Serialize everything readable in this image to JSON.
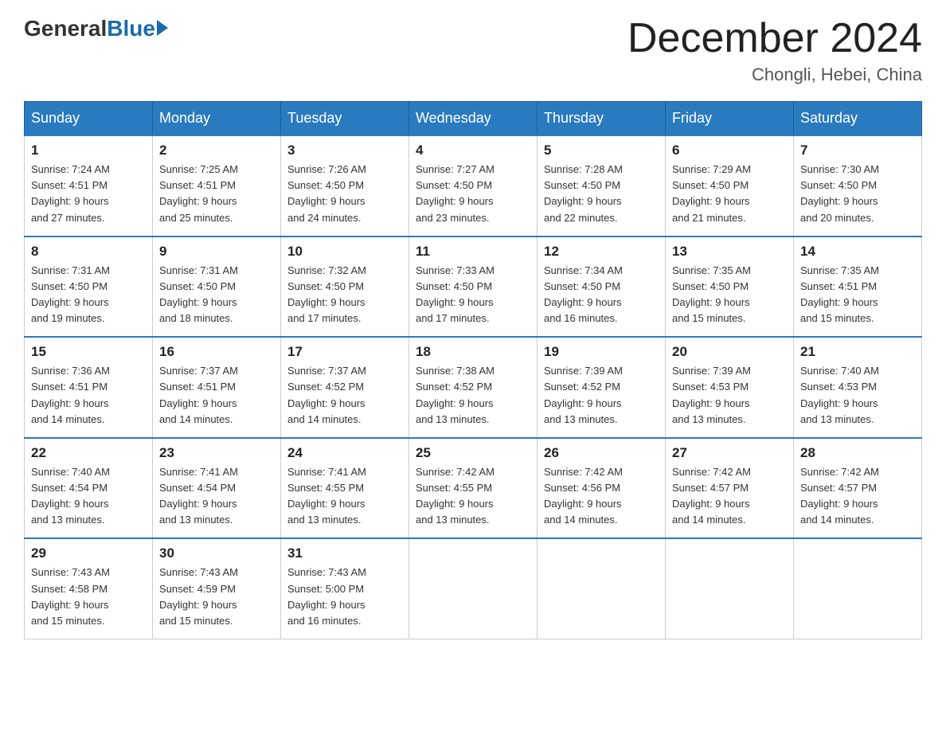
{
  "logo": {
    "general": "General",
    "blue": "Blue"
  },
  "title": "December 2024",
  "location": "Chongli, Hebei, China",
  "days_of_week": [
    "Sunday",
    "Monday",
    "Tuesday",
    "Wednesday",
    "Thursday",
    "Friday",
    "Saturday"
  ],
  "weeks": [
    [
      {
        "day": "1",
        "sunrise": "7:24 AM",
        "sunset": "4:51 PM",
        "daylight": "9 hours and 27 minutes."
      },
      {
        "day": "2",
        "sunrise": "7:25 AM",
        "sunset": "4:51 PM",
        "daylight": "9 hours and 25 minutes."
      },
      {
        "day": "3",
        "sunrise": "7:26 AM",
        "sunset": "4:50 PM",
        "daylight": "9 hours and 24 minutes."
      },
      {
        "day": "4",
        "sunrise": "7:27 AM",
        "sunset": "4:50 PM",
        "daylight": "9 hours and 23 minutes."
      },
      {
        "day": "5",
        "sunrise": "7:28 AM",
        "sunset": "4:50 PM",
        "daylight": "9 hours and 22 minutes."
      },
      {
        "day": "6",
        "sunrise": "7:29 AM",
        "sunset": "4:50 PM",
        "daylight": "9 hours and 21 minutes."
      },
      {
        "day": "7",
        "sunrise": "7:30 AM",
        "sunset": "4:50 PM",
        "daylight": "9 hours and 20 minutes."
      }
    ],
    [
      {
        "day": "8",
        "sunrise": "7:31 AM",
        "sunset": "4:50 PM",
        "daylight": "9 hours and 19 minutes."
      },
      {
        "day": "9",
        "sunrise": "7:31 AM",
        "sunset": "4:50 PM",
        "daylight": "9 hours and 18 minutes."
      },
      {
        "day": "10",
        "sunrise": "7:32 AM",
        "sunset": "4:50 PM",
        "daylight": "9 hours and 17 minutes."
      },
      {
        "day": "11",
        "sunrise": "7:33 AM",
        "sunset": "4:50 PM",
        "daylight": "9 hours and 17 minutes."
      },
      {
        "day": "12",
        "sunrise": "7:34 AM",
        "sunset": "4:50 PM",
        "daylight": "9 hours and 16 minutes."
      },
      {
        "day": "13",
        "sunrise": "7:35 AM",
        "sunset": "4:50 PM",
        "daylight": "9 hours and 15 minutes."
      },
      {
        "day": "14",
        "sunrise": "7:35 AM",
        "sunset": "4:51 PM",
        "daylight": "9 hours and 15 minutes."
      }
    ],
    [
      {
        "day": "15",
        "sunrise": "7:36 AM",
        "sunset": "4:51 PM",
        "daylight": "9 hours and 14 minutes."
      },
      {
        "day": "16",
        "sunrise": "7:37 AM",
        "sunset": "4:51 PM",
        "daylight": "9 hours and 14 minutes."
      },
      {
        "day": "17",
        "sunrise": "7:37 AM",
        "sunset": "4:52 PM",
        "daylight": "9 hours and 14 minutes."
      },
      {
        "day": "18",
        "sunrise": "7:38 AM",
        "sunset": "4:52 PM",
        "daylight": "9 hours and 13 minutes."
      },
      {
        "day": "19",
        "sunrise": "7:39 AM",
        "sunset": "4:52 PM",
        "daylight": "9 hours and 13 minutes."
      },
      {
        "day": "20",
        "sunrise": "7:39 AM",
        "sunset": "4:53 PM",
        "daylight": "9 hours and 13 minutes."
      },
      {
        "day": "21",
        "sunrise": "7:40 AM",
        "sunset": "4:53 PM",
        "daylight": "9 hours and 13 minutes."
      }
    ],
    [
      {
        "day": "22",
        "sunrise": "7:40 AM",
        "sunset": "4:54 PM",
        "daylight": "9 hours and 13 minutes."
      },
      {
        "day": "23",
        "sunrise": "7:41 AM",
        "sunset": "4:54 PM",
        "daylight": "9 hours and 13 minutes."
      },
      {
        "day": "24",
        "sunrise": "7:41 AM",
        "sunset": "4:55 PM",
        "daylight": "9 hours and 13 minutes."
      },
      {
        "day": "25",
        "sunrise": "7:42 AM",
        "sunset": "4:55 PM",
        "daylight": "9 hours and 13 minutes."
      },
      {
        "day": "26",
        "sunrise": "7:42 AM",
        "sunset": "4:56 PM",
        "daylight": "9 hours and 14 minutes."
      },
      {
        "day": "27",
        "sunrise": "7:42 AM",
        "sunset": "4:57 PM",
        "daylight": "9 hours and 14 minutes."
      },
      {
        "day": "28",
        "sunrise": "7:42 AM",
        "sunset": "4:57 PM",
        "daylight": "9 hours and 14 minutes."
      }
    ],
    [
      {
        "day": "29",
        "sunrise": "7:43 AM",
        "sunset": "4:58 PM",
        "daylight": "9 hours and 15 minutes."
      },
      {
        "day": "30",
        "sunrise": "7:43 AM",
        "sunset": "4:59 PM",
        "daylight": "9 hours and 15 minutes."
      },
      {
        "day": "31",
        "sunrise": "7:43 AM",
        "sunset": "5:00 PM",
        "daylight": "9 hours and 16 minutes."
      },
      null,
      null,
      null,
      null
    ]
  ],
  "labels": {
    "sunrise": "Sunrise:",
    "sunset": "Sunset:",
    "daylight": "Daylight:"
  }
}
